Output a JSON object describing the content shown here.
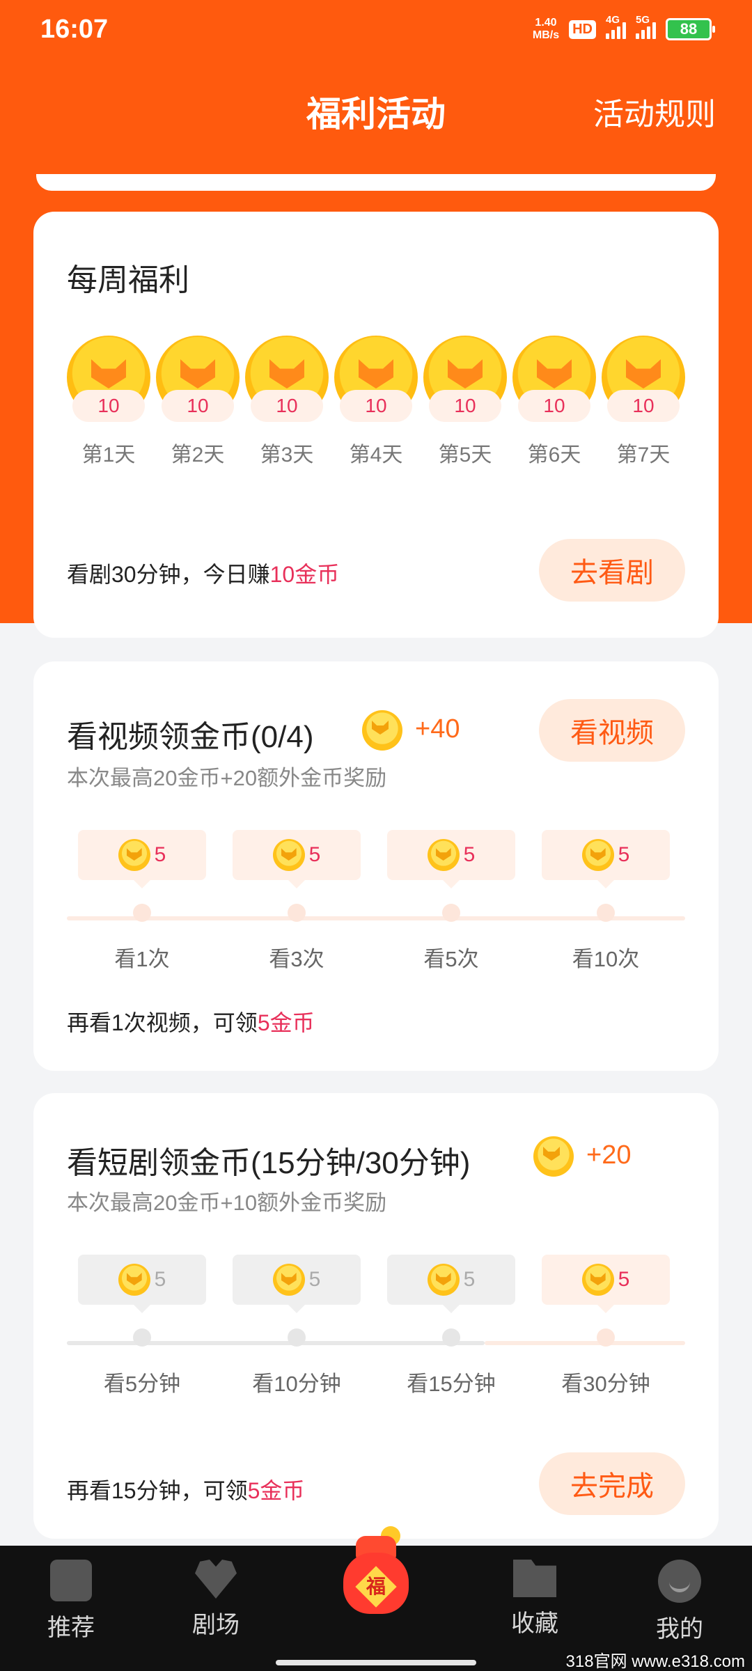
{
  "status_bar": {
    "time": "16:07",
    "net_speed_value": "1.40",
    "net_speed_unit": "MB/s",
    "hd": "HD",
    "sim1": "4G",
    "sim2": "5G",
    "battery": "88"
  },
  "header": {
    "title": "福利活动",
    "rules": "活动规则"
  },
  "weekly": {
    "title": "每周福利",
    "days": [
      {
        "amount": "10",
        "label": "第1天"
      },
      {
        "amount": "10",
        "label": "第2天"
      },
      {
        "amount": "10",
        "label": "第3天"
      },
      {
        "amount": "10",
        "label": "第4天"
      },
      {
        "amount": "10",
        "label": "第5天"
      },
      {
        "amount": "10",
        "label": "第6天"
      },
      {
        "amount": "10",
        "label": "第7天"
      }
    ],
    "info_prefix": "看剧30分钟，今日赚",
    "info_highlight": "10金币",
    "button": "去看剧"
  },
  "video": {
    "title": "看视频领金币(0/4)",
    "bonus": "+40",
    "subtitle": "本次最高20金币+20额外金币奖励",
    "button": "看视频",
    "milestones": [
      {
        "amount": "5",
        "label": "看1次"
      },
      {
        "amount": "5",
        "label": "看3次"
      },
      {
        "amount": "5",
        "label": "看5次"
      },
      {
        "amount": "5",
        "label": "看10次"
      }
    ],
    "info_prefix": "再看1次视频，可领",
    "info_highlight": "5金币"
  },
  "drama": {
    "title": "看短剧领金币(15分钟/30分钟)",
    "bonus": "+20",
    "subtitle": "本次最高20金币+10额外金币奖励",
    "milestones": [
      {
        "amount": "5",
        "label": "看5分钟"
      },
      {
        "amount": "5",
        "label": "看10分钟"
      },
      {
        "amount": "5",
        "label": "看15分钟"
      },
      {
        "amount": "5",
        "label": "看30分钟"
      }
    ],
    "info_prefix": "再看15分钟，可领",
    "info_highlight": "5金币",
    "button": "去完成"
  },
  "bottom_nav": {
    "items": [
      {
        "label": "推荐",
        "icon": "recommend-icon"
      },
      {
        "label": "剧场",
        "icon": "theater-icon"
      },
      {
        "label": "",
        "icon": "lucky-bag-icon"
      },
      {
        "label": "收藏",
        "icon": "favorites-icon"
      },
      {
        "label": "我的",
        "icon": "profile-icon"
      }
    ],
    "bag_char": "福"
  },
  "watermark": "318官网 www.e318.com",
  "colors": {
    "brand_orange": "#ff5a0e",
    "highlight_red": "#e8305a",
    "button_bg": "#ffeadc"
  }
}
